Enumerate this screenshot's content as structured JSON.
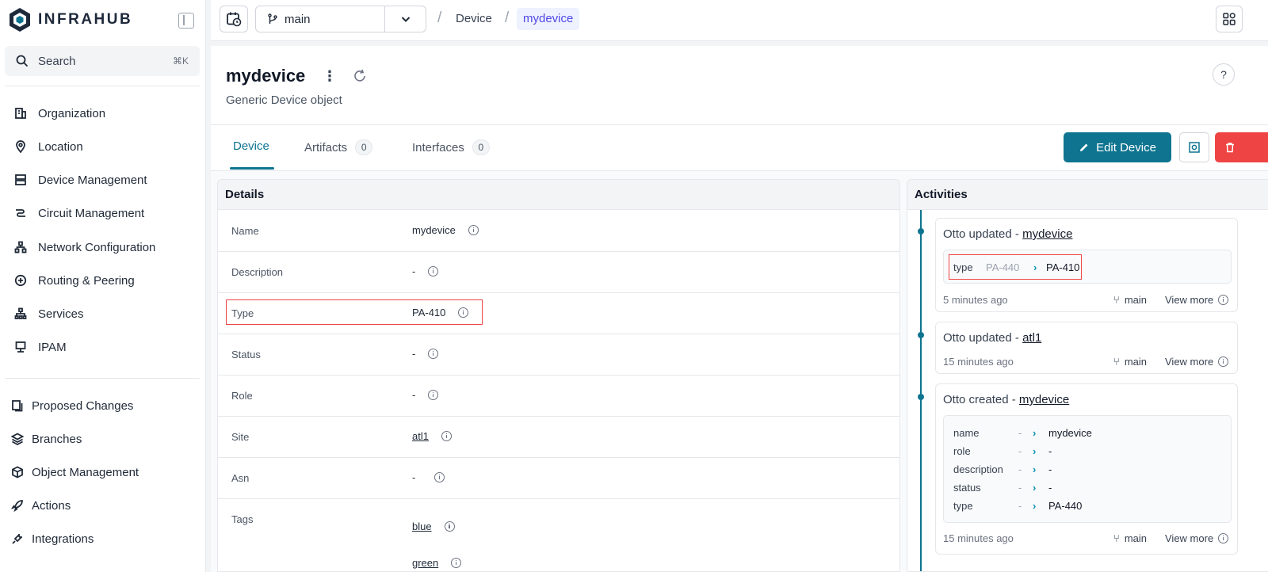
{
  "app": {
    "logo_text": "INFRAHUB"
  },
  "search": {
    "label": "Search",
    "shortcut": "⌘K"
  },
  "sidebar": {
    "primary": [
      {
        "label": "Organization",
        "icon": "building-icon"
      },
      {
        "label": "Location",
        "icon": "map-pin-icon"
      },
      {
        "label": "Device Management",
        "icon": "server-icon"
      },
      {
        "label": "Circuit Management",
        "icon": "circuit-icon"
      },
      {
        "label": "Network Configuration",
        "icon": "network-icon"
      },
      {
        "label": "Routing & Peering",
        "icon": "routing-icon"
      },
      {
        "label": "Services",
        "icon": "services-icon"
      },
      {
        "label": "IPAM",
        "icon": "ipam-icon"
      }
    ],
    "secondary": [
      {
        "label": "Proposed Changes",
        "icon": "proposed-changes-icon"
      },
      {
        "label": "Branches",
        "icon": "layers-icon"
      },
      {
        "label": "Object Management",
        "icon": "cube-icon"
      },
      {
        "label": "Actions",
        "icon": "rocket-icon"
      },
      {
        "label": "Integrations",
        "icon": "plug-icon"
      }
    ]
  },
  "topbar": {
    "branch": "main",
    "breadcrumb": [
      "Device",
      "mydevice"
    ]
  },
  "header": {
    "title": "mydevice",
    "subtitle": "Generic Device object",
    "help": "?"
  },
  "tabs": [
    {
      "label": "Device",
      "count": null
    },
    {
      "label": "Artifacts",
      "count": "0"
    },
    {
      "label": "Interfaces",
      "count": "0"
    }
  ],
  "actions": {
    "edit_label": "Edit Device"
  },
  "details": {
    "heading": "Details",
    "rows": [
      {
        "label": "Name",
        "value": "mydevice"
      },
      {
        "label": "Description",
        "value": "-"
      },
      {
        "label": "Type",
        "value": "PA-410"
      },
      {
        "label": "Status",
        "value": "-"
      },
      {
        "label": "Role",
        "value": "-"
      },
      {
        "label": "Site",
        "value": "atl1"
      },
      {
        "label": "Asn",
        "value": "-"
      },
      {
        "label": "Tags",
        "values": [
          "blue",
          "green"
        ]
      }
    ]
  },
  "activities": {
    "heading": "Activities",
    "items": [
      {
        "prefix": "Otto updated - ",
        "target": "mydevice",
        "changes": [
          {
            "key": "type",
            "old": "PA-440",
            "new": "PA-410"
          }
        ],
        "time": "5 minutes ago",
        "branch": "main",
        "more": "View more"
      },
      {
        "prefix": "Otto updated - ",
        "target": "atl1",
        "time": "15 minutes ago",
        "branch": "main",
        "more": "View more"
      },
      {
        "prefix": "Otto created - ",
        "target": "mydevice",
        "changes": [
          {
            "key": "name",
            "old": "-",
            "new": "mydevice"
          },
          {
            "key": "role",
            "old": "-",
            "new": "-"
          },
          {
            "key": "description",
            "old": "-",
            "new": "-"
          },
          {
            "key": "status",
            "old": "-",
            "new": "-"
          },
          {
            "key": "type",
            "old": "-",
            "new": "PA-440"
          }
        ],
        "time": "15 minutes ago",
        "branch": "main",
        "more": "View more"
      }
    ]
  },
  "colors": {
    "accent": "#0e7490",
    "danger": "#ef4444",
    "breadcrumb_active": "#4f46e5"
  }
}
